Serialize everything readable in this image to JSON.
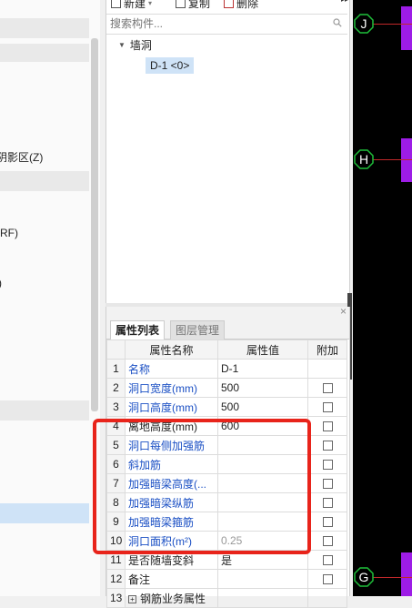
{
  "left_panel": {
    "texts": [
      "阴影区(Z)",
      "(RF)",
      ")"
    ]
  },
  "toolbar": {
    "new_label": "新建",
    "copy_label": "复制",
    "delete_label": "删除",
    "overflow_glyph": "▸▸"
  },
  "search": {
    "placeholder": "搜索构件..."
  },
  "tree": {
    "root_label": "墙洞",
    "item_label": "D-1 <0>"
  },
  "property_panel": {
    "close_glyph": "×",
    "tabs": [
      "属性列表",
      "图层管理"
    ],
    "headers": {
      "name": "属性名称",
      "value": "属性值",
      "extra": "附加"
    },
    "rows": [
      {
        "num": "1",
        "name": "名称",
        "value": "D-1",
        "has_checkbox": false
      },
      {
        "num": "2",
        "name": "洞口宽度(mm)",
        "value": "500",
        "has_checkbox": true
      },
      {
        "num": "3",
        "name": "洞口高度(mm)",
        "value": "500",
        "has_checkbox": true
      },
      {
        "num": "4",
        "name": "离地高度(mm)",
        "value": "600",
        "has_checkbox": true
      },
      {
        "num": "5",
        "name": "洞口每侧加强筋",
        "value": "",
        "has_checkbox": true
      },
      {
        "num": "6",
        "name": "斜加筋",
        "value": "",
        "has_checkbox": true
      },
      {
        "num": "7",
        "name": "加强暗梁高度(...",
        "value": "",
        "has_checkbox": true
      },
      {
        "num": "8",
        "name": "加强暗梁纵筋",
        "value": "",
        "has_checkbox": true
      },
      {
        "num": "9",
        "name": "加强暗梁箍筋",
        "value": "",
        "has_checkbox": true
      },
      {
        "num": "10",
        "name": "洞口面积(m²)",
        "value": "0.25",
        "has_checkbox": true
      },
      {
        "num": "11",
        "name": "是否随墙变斜",
        "value": "是",
        "has_checkbox": true
      },
      {
        "num": "12",
        "name": "备注",
        "value": "",
        "has_checkbox": true
      },
      {
        "num": "13",
        "name": "钢筋业务属性",
        "value": "",
        "has_checkbox": false
      }
    ]
  },
  "canvas": {
    "axes": [
      "J",
      "H",
      "G"
    ]
  },
  "colors": {
    "annotation_red": "#e8241b",
    "axis_green": "#1fbf3a",
    "member_purple": "#9d1ce6",
    "property_blue": "#1a4fc4"
  }
}
